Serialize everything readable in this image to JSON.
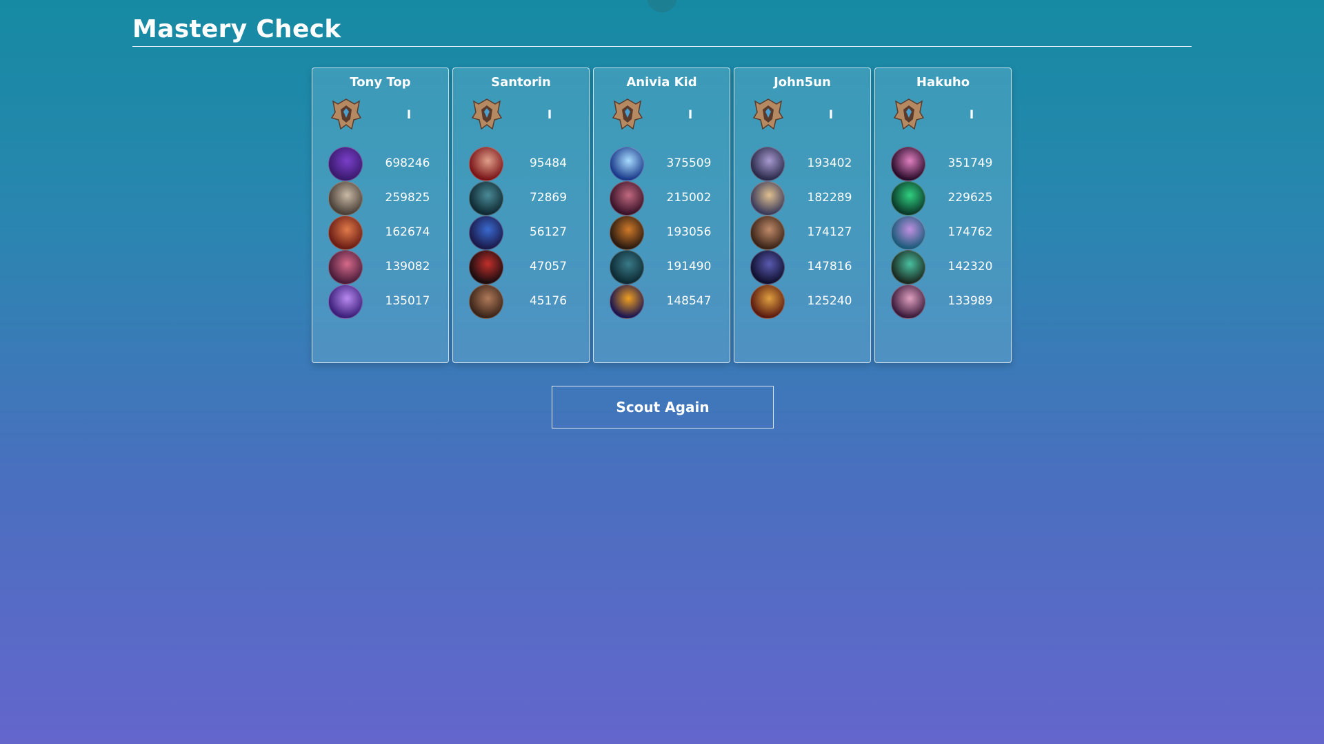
{
  "page": {
    "title": "Mastery Check"
  },
  "players": [
    {
      "name": "Tony Top",
      "tier": "I",
      "rank_icon": "rank-emblem-icon",
      "champions": [
        {
          "points": "698246",
          "icon": "champion-icon",
          "colors": [
            "#3a1a6e",
            "#7a3fc9"
          ]
        },
        {
          "points": "259825",
          "icon": "champion-icon",
          "colors": [
            "#4a4038",
            "#c9b9a6"
          ]
        },
        {
          "points": "162674",
          "icon": "champion-icon",
          "colors": [
            "#6b1d14",
            "#e07a4a"
          ]
        },
        {
          "points": "139082",
          "icon": "champion-icon",
          "colors": [
            "#4a1c3a",
            "#d66a8a"
          ]
        },
        {
          "points": "135017",
          "icon": "champion-icon",
          "colors": [
            "#3b1f7a",
            "#b98af0"
          ]
        }
      ]
    },
    {
      "name": "Santorin",
      "tier": "I",
      "rank_icon": "rank-emblem-icon",
      "champions": [
        {
          "points": "95484",
          "icon": "champion-icon",
          "colors": [
            "#7a1418",
            "#e0a08a"
          ]
        },
        {
          "points": "72869",
          "icon": "champion-icon",
          "colors": [
            "#0f2a33",
            "#4a8a96"
          ]
        },
        {
          "points": "56127",
          "icon": "champion-icon",
          "colors": [
            "#1a1a4a",
            "#3a6ad0"
          ]
        },
        {
          "points": "47057",
          "icon": "champion-icon",
          "colors": [
            "#1a0c10",
            "#c0302a"
          ]
        },
        {
          "points": "45176",
          "icon": "champion-icon",
          "colors": [
            "#3a2418",
            "#b07a5a"
          ]
        }
      ]
    },
    {
      "name": "Anivia Kid",
      "tier": "I",
      "rank_icon": "rank-emblem-icon",
      "champions": [
        {
          "points": "375509",
          "icon": "champion-icon",
          "colors": [
            "#1a3a8a",
            "#a8dcff"
          ]
        },
        {
          "points": "215002",
          "icon": "champion-icon",
          "colors": [
            "#3a1228",
            "#c06a80"
          ]
        },
        {
          "points": "193056",
          "icon": "champion-icon",
          "colors": [
            "#2a1a10",
            "#d07a2a"
          ]
        },
        {
          "points": "191490",
          "icon": "champion-icon",
          "colors": [
            "#0c2a33",
            "#3a7a88"
          ]
        },
        {
          "points": "148547",
          "icon": "champion-icon",
          "colors": [
            "#1a1450",
            "#f0a020"
          ]
        }
      ]
    },
    {
      "name": "John5un",
      "tier": "I",
      "rank_icon": "rank-emblem-icon",
      "champions": [
        {
          "points": "193402",
          "icon": "champion-icon",
          "colors": [
            "#2a2a4a",
            "#a89ad0"
          ]
        },
        {
          "points": "182289",
          "icon": "champion-icon",
          "colors": [
            "#3a3a5a",
            "#e0c090"
          ]
        },
        {
          "points": "174127",
          "icon": "champion-icon",
          "colors": [
            "#3a2418",
            "#c08a6a"
          ]
        },
        {
          "points": "147816",
          "icon": "champion-icon",
          "colors": [
            "#101030",
            "#5a5ab0"
          ]
        },
        {
          "points": "125240",
          "icon": "champion-icon",
          "colors": [
            "#5a1a10",
            "#e0a040"
          ]
        }
      ]
    },
    {
      "name": "Hakuho",
      "tier": "I",
      "rank_icon": "rank-emblem-icon",
      "champions": [
        {
          "points": "351749",
          "icon": "champion-icon",
          "colors": [
            "#2a0c2a",
            "#e080c0"
          ]
        },
        {
          "points": "229625",
          "icon": "champion-icon",
          "colors": [
            "#0a3a2a",
            "#30d080"
          ]
        },
        {
          "points": "174762",
          "icon": "champion-icon",
          "colors": [
            "#1a5a7a",
            "#c090e0"
          ]
        },
        {
          "points": "142320",
          "icon": "champion-icon",
          "colors": [
            "#1a2a20",
            "#4ac0a0"
          ]
        },
        {
          "points": "133989",
          "icon": "champion-icon",
          "colors": [
            "#3a1a3a",
            "#e0a0c0"
          ]
        }
      ]
    }
  ],
  "actions": {
    "scout_again": "Scout Again"
  },
  "colors": {
    "rank_metal": "#b58a62",
    "rank_dark": "#5a3a2a",
    "rank_gem": "#4aa0d0"
  }
}
